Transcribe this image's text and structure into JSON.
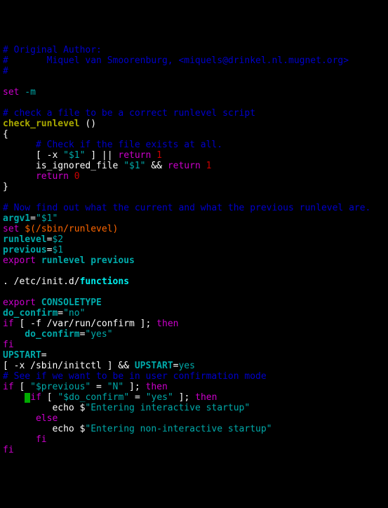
{
  "l1_a": "# Original Author:",
  "l2_a": "#       Miquel van Smoorenburg, <miquels@drinkel.nl.mugnet.org>",
  "l3_a": "#",
  "l4_set": "set",
  "l4_m": " -m",
  "l5_a": "# check a file to be a correct runlevel script",
  "l6_fn": "check_runlevel",
  "l6_par": " ()",
  "l7_a": "{",
  "l8_a": "      # Check if the file exists at all.",
  "l9_a": "      [ -x ",
  "l9_b": "\"$1\"",
  "l9_c": " ] || ",
  "l9_d": "return",
  "l9_e": " 1",
  "l10_a": "      is_ignored_file ",
  "l10_b": "\"$1\"",
  "l10_c": " && ",
  "l10_d": "return",
  "l10_e": " 1",
  "l11_a": "      ",
  "l11_b": "return",
  "l11_c": " 0",
  "l12_a": "}",
  "l13_a": "# Now find out what the current and what the previous runlevel are.",
  "l14_a": "argv1",
  "l14_eq": "=",
  "l14_b": "\"$1\"",
  "l15_set": "set",
  "l15_b": " $(/sbin/runlevel)",
  "l16_a": "runlevel",
  "l16_eq": "=",
  "l16_b": "$2",
  "l17_a": "previous",
  "l17_eq": "=",
  "l17_b": "$1",
  "l18_a": "export",
  "l18_b": " runlevel previous",
  "l19_a": ". /etc/init.d/",
  "l19_b": "functions",
  "l20_a": "export",
  "l20_b": " CONSOLETYPE",
  "l21_a": "do_confirm",
  "l21_eq": "=",
  "l21_b": "\"no\"",
  "l22_a": "if",
  "l22_b": " [ -f ",
  "l22_c": "/var/run/confirm",
  "l22_d": " ]; ",
  "l22_e": "then",
  "l23_a": "    do_confirm",
  "l23_eq": "=",
  "l23_b": "\"yes\"",
  "l24_a": "fi",
  "l25_a": "UPSTART",
  "l25_eq": "=",
  "l26_a": "[ -x ",
  "l26_b": "/sbin/initctl",
  "l26_c": " ] && ",
  "l26_d": "UPSTART",
  "l26_eq": "=",
  "l26_e": "yes",
  "l27_a": "# See if we want to be in user confirmation mode",
  "l28_a": "if",
  "l28_b": " [ ",
  "l28_c": "\"$previous\"",
  "l28_d": " = ",
  "l28_e": "\"N\"",
  "l28_f": " ]; ",
  "l28_g": "then",
  "l29_a": "    ",
  "l29_b": "if",
  "l29_c": " [ ",
  "l29_d": "\"$do_confirm\"",
  "l29_e": " = ",
  "l29_f": "\"yes\"",
  "l29_g": " ]; ",
  "l29_h": "then",
  "l30_a": "         echo $",
  "l30_b": "\"Entering interactive startup\"",
  "l31_a": "      ",
  "l31_b": "else",
  "l32_a": "         echo $",
  "l32_b": "\"Entering non-interactive startup\"",
  "l33_a": "      ",
  "l33_b": "fi",
  "l34_a": "fi"
}
